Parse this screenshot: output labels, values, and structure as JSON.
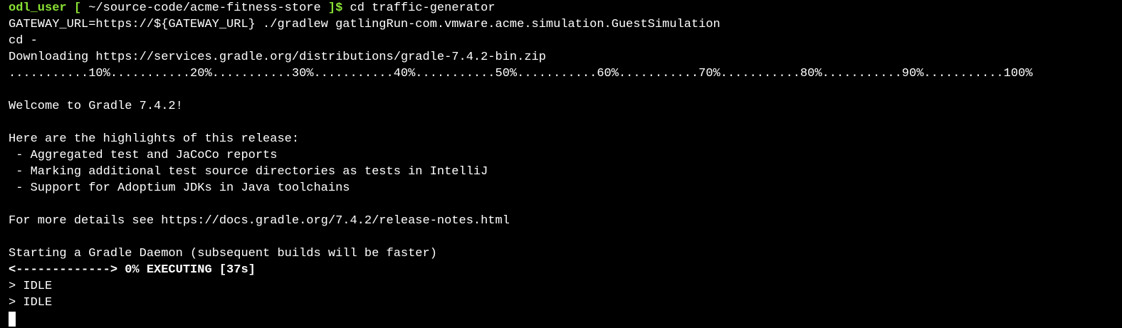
{
  "terminal": {
    "prompt": {
      "user": "odl_user",
      "open_bracket": "[",
      "path": "~/source-code/acme-fitness-store",
      "close_bracket": "]$",
      "command": "cd traffic-generator"
    },
    "lines": [
      "GATEWAY_URL=https://${GATEWAY_URL} ./gradlew gatlingRun-com.vmware.acme.simulation.GuestSimulation",
      "cd -",
      "Downloading https://services.gradle.org/distributions/gradle-7.4.2-bin.zip",
      "...........10%...........20%...........30%...........40%...........50%...........60%...........70%...........80%...........90%...........100%",
      "",
      "Welcome to Gradle 7.4.2!",
      "",
      "Here are the highlights of this release:",
      " - Aggregated test and JaCoCo reports",
      " - Marking additional test source directories as tests in IntelliJ",
      " - Support for Adoptium JDKs in Java toolchains",
      "",
      "For more details see https://docs.gradle.org/7.4.2/release-notes.html",
      "",
      "Starting a Gradle Daemon (subsequent builds will be faster)"
    ],
    "progress_line": "<-------------> 0% EXECUTING [37s]",
    "idle_lines": [
      "> IDLE",
      "> IDLE"
    ],
    "colors": {
      "background": "#000000",
      "text": "#ffffff",
      "prompt_accent": "#8ae234"
    }
  }
}
